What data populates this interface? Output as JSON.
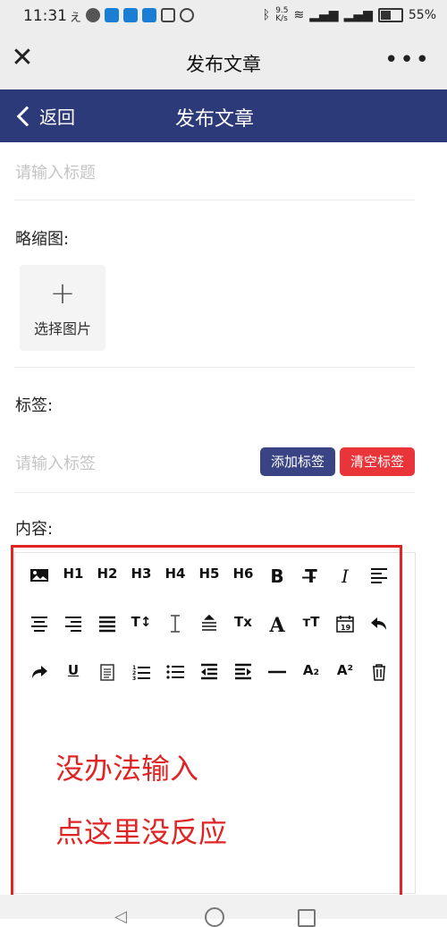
{
  "status": {
    "time": "11:31",
    "net_speed": "9.5\nK/s",
    "battery": "55%",
    "battery_level": 0.55,
    "notification_icons": [
      "input-icon",
      "chat-icon",
      "app-icon",
      "app-icon",
      "cloud-icon",
      "nfc-icon",
      "alarm-icon"
    ],
    "right_icons": [
      "bluetooth-icon",
      "wifi-icon",
      "signal-4g-icon",
      "signal-4g-icon"
    ]
  },
  "wechat": {
    "close": "✕",
    "title": "发布文章",
    "more": "•••"
  },
  "nav": {
    "back": "返回",
    "title": "发布文章"
  },
  "form": {
    "title_placeholder": "请输入标题",
    "thumbnail_label": "略缩图:",
    "select_image": "选择图片",
    "tags_label": "标签:",
    "tag_placeholder": "请输入标签",
    "add_tag": "添加标签",
    "clear_tags": "清空标签",
    "content_label": "内容:"
  },
  "toolbar": [
    {
      "name": "image-icon"
    },
    {
      "name": "h1",
      "text": "H1"
    },
    {
      "name": "h2",
      "text": "H2"
    },
    {
      "name": "h3",
      "text": "H3"
    },
    {
      "name": "h4",
      "text": "H4"
    },
    {
      "name": "h5",
      "text": "H5"
    },
    {
      "name": "h6",
      "text": "H6"
    },
    {
      "name": "bold",
      "text": "B"
    },
    {
      "name": "strikethrough",
      "text": "T̶"
    },
    {
      "name": "italic",
      "text": "I"
    },
    {
      "name": "align-left-icon"
    },
    {
      "name": "align-center-icon"
    },
    {
      "name": "align-right-icon"
    },
    {
      "name": "justify-icon"
    },
    {
      "name": "font-size",
      "text": "T↕"
    },
    {
      "name": "line-height-icon"
    },
    {
      "name": "paragraph-spacing-icon"
    },
    {
      "name": "clear-format",
      "text": "Tx"
    },
    {
      "name": "font",
      "text": "A"
    },
    {
      "name": "text-size",
      "text": "тT"
    },
    {
      "name": "calendar-icon",
      "text": "19"
    },
    {
      "name": "undo-icon"
    },
    {
      "name": "redo-icon"
    },
    {
      "name": "underline",
      "text": "U"
    },
    {
      "name": "clipboard-icon"
    },
    {
      "name": "ordered-list-icon"
    },
    {
      "name": "bullet-list-icon"
    },
    {
      "name": "outdent-icon"
    },
    {
      "name": "indent-icon"
    },
    {
      "name": "horizontal-rule-icon"
    },
    {
      "name": "subscript",
      "text": "A₂"
    },
    {
      "name": "superscript",
      "text": "A²"
    },
    {
      "name": "delete-icon"
    }
  ],
  "annotations": [
    "没办法输入",
    "点这里没反应"
  ],
  "colors": {
    "nav": "#2d3a7a",
    "add_button": "#3a4484",
    "clear_button": "#e9343a",
    "annotation": "#e02424"
  }
}
